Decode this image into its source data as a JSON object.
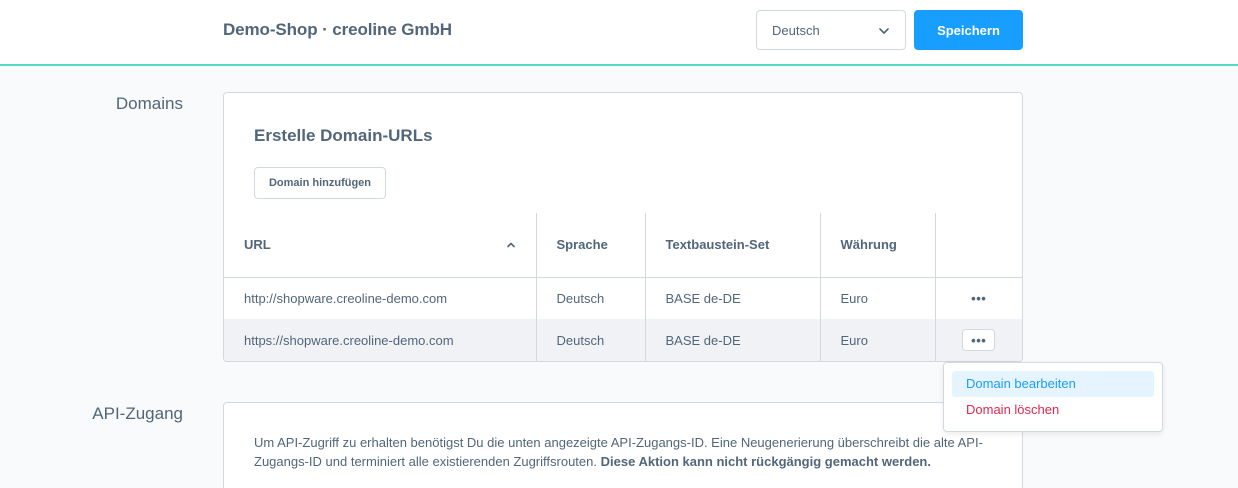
{
  "header": {
    "shop_title": "Demo-Shop · creoline GmbH",
    "language_selected": "Deutsch",
    "save_label": "Speichern"
  },
  "domains": {
    "section_label": "Domains",
    "card_title": "Erstelle Domain-URLs",
    "add_button_label": "Domain hinzufügen",
    "columns": [
      "URL",
      "Sprache",
      "Textbaustein-Set",
      "Währung"
    ],
    "rows": [
      {
        "url": "http://shopware.creoline-demo.com",
        "language": "Deutsch",
        "snippet_set": "BASE de-DE",
        "currency": "Euro"
      },
      {
        "url": "https://shopware.creoline-demo.com",
        "language": "Deutsch",
        "snippet_set": "BASE de-DE",
        "currency": "Euro"
      }
    ],
    "row_action_label": "•••"
  },
  "context_menu": {
    "edit_label": "Domain bearbeiten",
    "delete_label": "Domain löschen"
  },
  "api": {
    "section_label": "API-Zugang",
    "description": "Um API-Zugriff zu erhalten benötigst Du die unten angezeigte API-Zugangs-ID. Eine Neugenerierung überschreibt die alte API-Zugangs-ID und terminiert alle existierenden Zugriffsrouten.",
    "warning": "Diese Aktion kann nicht rückgängig gemacht werden."
  },
  "colors": {
    "accent": "#189eff",
    "topbar_border": "#57d9c4",
    "danger": "#de294c",
    "text": "#52667a"
  }
}
